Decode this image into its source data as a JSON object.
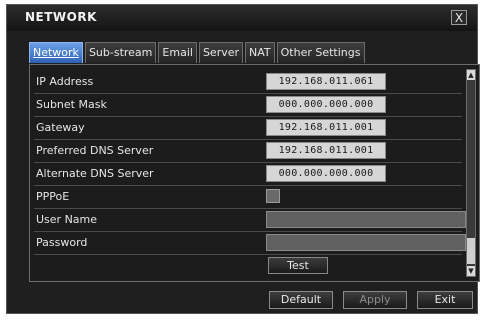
{
  "window": {
    "title": "NETWORK",
    "close_glyph": "X"
  },
  "tabs": [
    "Network",
    "Sub-stream",
    "Email",
    "Server",
    "NAT",
    "Other Settings"
  ],
  "active_tab": "Network",
  "fields": {
    "ip_address": {
      "label": "IP Address",
      "value": "192.168.011.061"
    },
    "subnet_mask": {
      "label": "Subnet Mask",
      "value": "000.000.000.000"
    },
    "gateway": {
      "label": "Gateway",
      "value": "192.168.011.001"
    },
    "preferred_dns": {
      "label": "Preferred DNS Server",
      "value": "192.168.011.001"
    },
    "alternate_dns": {
      "label": "Alternate DNS Server",
      "value": "000.000.000.000"
    },
    "pppoe": {
      "label": "PPPoE",
      "checked": false
    },
    "user_name": {
      "label": "User Name",
      "value": ""
    },
    "password": {
      "label": "Password",
      "value": ""
    }
  },
  "test_label": "Test",
  "footer": {
    "default": "Default",
    "apply": "Apply",
    "exit": "Exit"
  },
  "colors": {
    "active_tab": "#2c62b6",
    "background": "#1f1f1f"
  }
}
